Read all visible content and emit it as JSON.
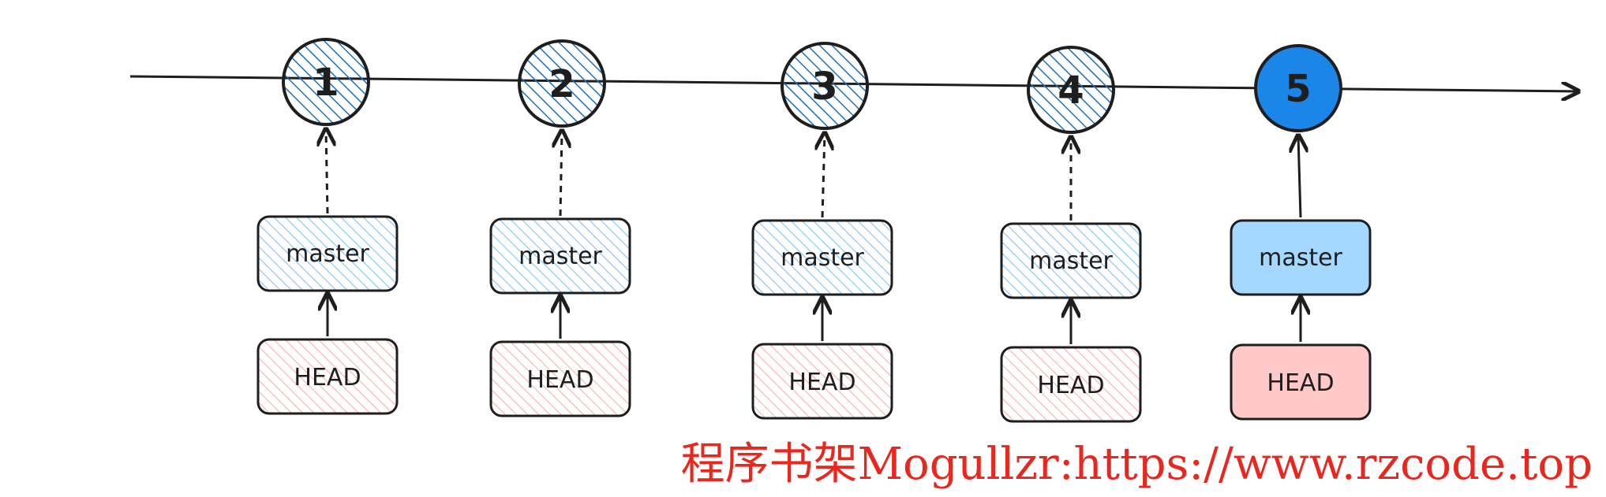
{
  "commits": [
    {
      "label": "1",
      "current": false
    },
    {
      "label": "2",
      "current": false
    },
    {
      "label": "3",
      "current": false
    },
    {
      "label": "4",
      "current": false
    },
    {
      "label": "5",
      "current": true
    }
  ],
  "branch_label": "master",
  "head_label": "HEAD",
  "colors": {
    "line": "#1e1e1e",
    "commit_hatch": "#1971c2",
    "commit_current": "#1c86e8",
    "branch_hatch": "#74c0fc",
    "branch_fill_current": "#a5d8ff",
    "head_hatch": "#ffa8a8",
    "head_fill_current": "#ffc9c9",
    "watermark": "#e8281e"
  },
  "watermark": "程序书架Mogullzr:https://www.rzcode.top"
}
